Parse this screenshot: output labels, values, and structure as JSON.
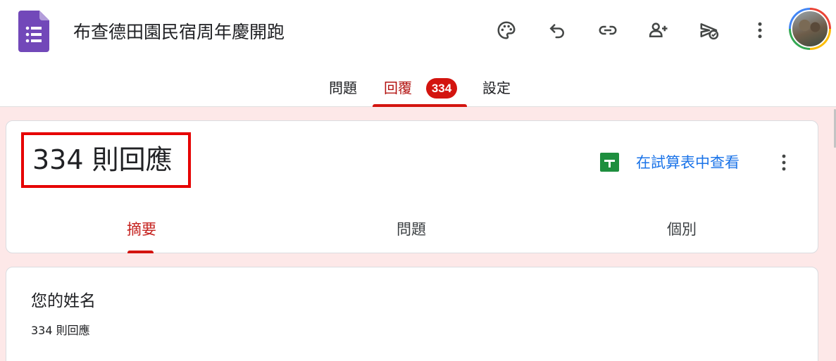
{
  "header": {
    "doc_title": "布查德田園民宿周年慶開跑",
    "icons": [
      "palette-icon",
      "undo-icon",
      "link-icon",
      "add-person-icon",
      "send-check-icon",
      "more-vert-icon"
    ]
  },
  "top_tabs": {
    "questions": "問題",
    "responses": "回覆",
    "responses_badge": "334",
    "settings": "設定"
  },
  "summary_card": {
    "title": "334 則回應",
    "sheets_link": "在試算表中查看",
    "sub_tabs": {
      "summary": "摘要",
      "question": "問題",
      "individual": "個別"
    }
  },
  "question_card": {
    "title": "您的姓名",
    "count": "334 則回應"
  },
  "colors": {
    "accent": "#d3140f",
    "page_tint": "#fde8e8",
    "link": "#1a73e8",
    "forms_purple": "#7248b9",
    "sheets_green": "#1e8e3e"
  }
}
